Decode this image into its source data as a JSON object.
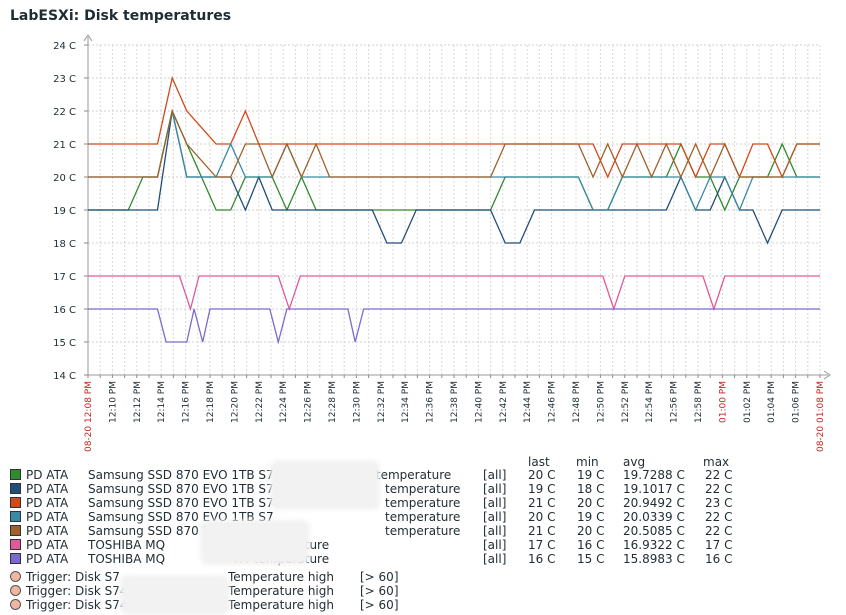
{
  "title": "LabESXi: Disk temperatures",
  "chart_data": {
    "type": "line",
    "title": "LabESXi: Disk temperatures",
    "ylim": [
      14,
      24
    ],
    "y_ticks": [
      "14 C",
      "15 C",
      "16 C",
      "17 C",
      "18 C",
      "19 C",
      "20 C",
      "21 C",
      "22 C",
      "23 C",
      "24 C"
    ],
    "x_ticks": [
      "12:10 PM",
      "12:12 PM",
      "12:14 PM",
      "12:16 PM",
      "12:18 PM",
      "12:20 PM",
      "12:22 PM",
      "12:24 PM",
      "12:26 PM",
      "12:28 PM",
      "12:30 PM",
      "12:32 PM",
      "12:34 PM",
      "12:36 PM",
      "12:38 PM",
      "12:40 PM",
      "12:42 PM",
      "12:44 PM",
      "12:46 PM",
      "12:48 PM",
      "12:50 PM",
      "12:52 PM",
      "12:54 PM",
      "12:56 PM",
      "12:58 PM",
      "01:00 PM",
      "01:02 PM",
      "01:04 PM",
      "01:06 PM"
    ],
    "x_start_label": "08-20 12:08 PM",
    "x_end_label": "08-20 01:08 PM",
    "x_highlight_label": "01:00 PM",
    "x_range_minutes": [
      0,
      60
    ],
    "grid": true,
    "series": [
      {
        "name": "PD ATA Samsung SSD 870 EVO 1TB S7 temperature",
        "color": "#2e8b2e",
        "x": [
          0,
          3.3,
          4.5,
          5.7,
          6.9,
          8.1,
          9.3,
          10.5,
          11.7,
          12.9,
          14.0,
          15.1,
          16.3,
          17.5,
          18.7,
          19.8,
          21,
          22.2,
          23.3,
          33,
          34.2,
          35.4,
          39,
          40.2,
          41.4,
          42.6,
          43.8,
          46.2,
          47.4,
          48.6,
          49.8,
          51,
          52.2,
          53.4,
          54.5,
          55.7,
          56.9,
          58.1,
          60
        ],
        "y": [
          19,
          19,
          20,
          20,
          22,
          21,
          20,
          19,
          19,
          20,
          20,
          20,
          19,
          20,
          19,
          19,
          19,
          19,
          19,
          19,
          20,
          20,
          20,
          20,
          19,
          19,
          20,
          20,
          20,
          21,
          20,
          20,
          19,
          20,
          20,
          20,
          21,
          20,
          20
        ]
      },
      {
        "name": "PD ATA Samsung SSD 870 EVO 1TB S74 temperature",
        "color": "#1f4e79",
        "x": [
          0,
          5.7,
          6.9,
          8.1,
          10.5,
          11.7,
          12.9,
          14.0,
          15.1,
          17.5,
          19.8,
          23.3,
          24.5,
          25.7,
          26.9,
          33,
          34.2,
          35.4,
          36.6,
          39,
          40.2,
          45,
          46.2,
          47.4,
          48.6,
          49.8,
          51,
          52.2,
          53.4,
          54.5,
          55.7,
          56.9,
          60
        ],
        "y": [
          19,
          19,
          22,
          20,
          20,
          20,
          19,
          20,
          19,
          19,
          19,
          19,
          18,
          18,
          19,
          19,
          18,
          18,
          19,
          19,
          19,
          19,
          19,
          19,
          20,
          19,
          19,
          20,
          19,
          19,
          18,
          19,
          19
        ]
      },
      {
        "name": "PD ATA Samsung SSD 870 EVO 1TB S74 temperature",
        "color": "#d2491b",
        "x": [
          0,
          5.7,
          6.9,
          8.1,
          10.5,
          11.7,
          12.9,
          14.0,
          40.2,
          41.4,
          42.6,
          43.8,
          45,
          46.2,
          47.4,
          48.6,
          49.8,
          51,
          52.2,
          53.4,
          54.5,
          55.7,
          56.9,
          58.1,
          60
        ],
        "y": [
          21,
          21,
          23,
          22,
          21,
          21,
          22,
          21,
          21,
          21,
          20,
          21,
          21,
          21,
          21,
          21,
          20,
          21,
          21,
          20,
          21,
          21,
          20,
          21,
          21
        ]
      },
      {
        "name": "PD ATA Samsung SSD 870 EVO 1TB S7 temperature",
        "color": "#3a8aa3",
        "x": [
          0,
          5.7,
          6.9,
          8.1,
          10.5,
          11.7,
          12.9,
          14.0,
          15.1,
          16.3,
          17.5,
          18.7,
          19.8,
          21,
          22.2,
          23.3,
          29.3,
          30.5,
          31.7,
          35.4,
          40.2,
          41.4,
          42.6,
          43.8,
          45,
          46.2,
          47.4,
          48.6,
          49.8,
          51,
          52.2,
          53.4,
          54.5,
          55.7,
          60
        ],
        "y": [
          20,
          20,
          22,
          20,
          20,
          21,
          20,
          20,
          20,
          21,
          20,
          20,
          20,
          20,
          20,
          20,
          20,
          20,
          20,
          20,
          20,
          19,
          19,
          20,
          20,
          20,
          20,
          20,
          19,
          20,
          20,
          19,
          20,
          20,
          20
        ]
      },
      {
        "name": "PD ATA Samsung SSD 870 EVO 1TB S74 temperature",
        "color": "#a0612a",
        "x": [
          0,
          5.7,
          6.9,
          8.1,
          10.5,
          11.7,
          12.9,
          14.0,
          15.1,
          16.3,
          17.5,
          18.7,
          19.8,
          21,
          22.2,
          23.3,
          33,
          34.2,
          35.4,
          36.6,
          37.8,
          39,
          40.2,
          41.4,
          42.6,
          43.8,
          45,
          46.2,
          47.4,
          48.6,
          49.8,
          51,
          52.2,
          53.4,
          54.5,
          55.7,
          56.9,
          58.1,
          60
        ],
        "y": [
          20,
          20,
          22,
          21,
          20,
          20,
          21,
          21,
          20,
          21,
          20,
          21,
          20,
          20,
          20,
          20,
          20,
          21,
          21,
          21,
          21,
          21,
          21,
          20,
          21,
          20,
          21,
          20,
          21,
          20,
          21,
          20,
          21,
          20,
          20,
          20,
          20,
          21,
          21
        ]
      },
      {
        "name": "PD ATA TOSHIBA MQ X4 temperature",
        "color": "#e05a9a",
        "x": [
          0,
          7.5,
          8.4,
          9.1,
          15.6,
          16.5,
          17.4,
          42.2,
          43.1,
          44,
          50.4,
          51.3,
          52.2,
          60
        ],
        "y": [
          17,
          17,
          16,
          17,
          17,
          16,
          17,
          17,
          16,
          17,
          17,
          16,
          17,
          17
        ]
      },
      {
        "name": "PD ATA TOSHIBA MQ X4 temperature",
        "color": "#7a6acf",
        "x": [
          0,
          5.7,
          6.4,
          8.1,
          8.7,
          9.4,
          10,
          10.7,
          14.9,
          15.6,
          16.3,
          21.3,
          21.9,
          22.6,
          60
        ],
        "y": [
          16,
          16,
          15,
          15,
          16,
          15,
          16,
          16,
          16,
          15,
          16,
          16,
          15,
          16,
          16
        ]
      }
    ]
  },
  "legend": {
    "headers": {
      "last": "last",
      "min": "min",
      "avg": "avg",
      "max": "max"
    },
    "rows": [
      {
        "src": "PD ATA",
        "name": "Samsung SSD 870 EVO 1TB S7",
        "suffix": ": temperature",
        "func": "[all]",
        "last": "20 C",
        "min": "19 C",
        "avg": "19.7288 C",
        "max": "22 C",
        "color": "#2e8b2e"
      },
      {
        "src": "PD ATA",
        "name": "Samsung SSD 870 EVO 1TB S74",
        "suffix": "temperature",
        "func": "[all]",
        "last": "19 C",
        "min": "18 C",
        "avg": "19.1017 C",
        "max": "22 C",
        "color": "#1f4e79"
      },
      {
        "src": "PD ATA",
        "name": "Samsung SSD 870 EVO 1TB S74",
        "suffix": "temperature",
        "func": "[all]",
        "last": "21 C",
        "min": "20 C",
        "avg": "20.9492 C",
        "max": "23 C",
        "color": "#d2491b"
      },
      {
        "src": "PD ATA",
        "name": "Samsung SSD 870 EVO 1TB S7",
        "suffix": "temperature",
        "func": "[all]",
        "last": "20 C",
        "min": "19 C",
        "avg": "20.0339 C",
        "max": "22 C",
        "color": "#3a8aa3"
      },
      {
        "src": "PD ATA",
        "name": "Samsung SSD 870 EVO 1TB S74",
        "suffix": "temperature",
        "func": "[all]",
        "last": "21 C",
        "min": "20 C",
        "avg": "20.5085 C",
        "max": "22 C",
        "color": "#a0612a"
      },
      {
        "src": "PD ATA",
        "name": "TOSHIBA MQ",
        "suffix": "X4 temperature",
        "func": "[all]",
        "last": "17 C",
        "min": "16 C",
        "avg": "16.9322 C",
        "max": "17 C",
        "color": "#e05a9a"
      },
      {
        "src": "PD ATA",
        "name": "TOSHIBA MQ",
        "suffix": "X4 temperature",
        "func": "[all]",
        "last": "16 C",
        "min": "15 C",
        "avg": "15.8983 C",
        "max": "16 C",
        "color": "#7a6acf"
      }
    ],
    "triggers": [
      {
        "name": "Trigger: Disk S7",
        "suffix": "Temperature high",
        "value": "[> 60]"
      },
      {
        "name": "Trigger: Disk S74",
        "suffix": "Temperature high",
        "value": "[> 60]"
      },
      {
        "name": "Trigger: Disk S74",
        "suffix": "Temperature high",
        "value": "[> 60]"
      }
    ],
    "trigger_color": "#f0b7a0"
  }
}
